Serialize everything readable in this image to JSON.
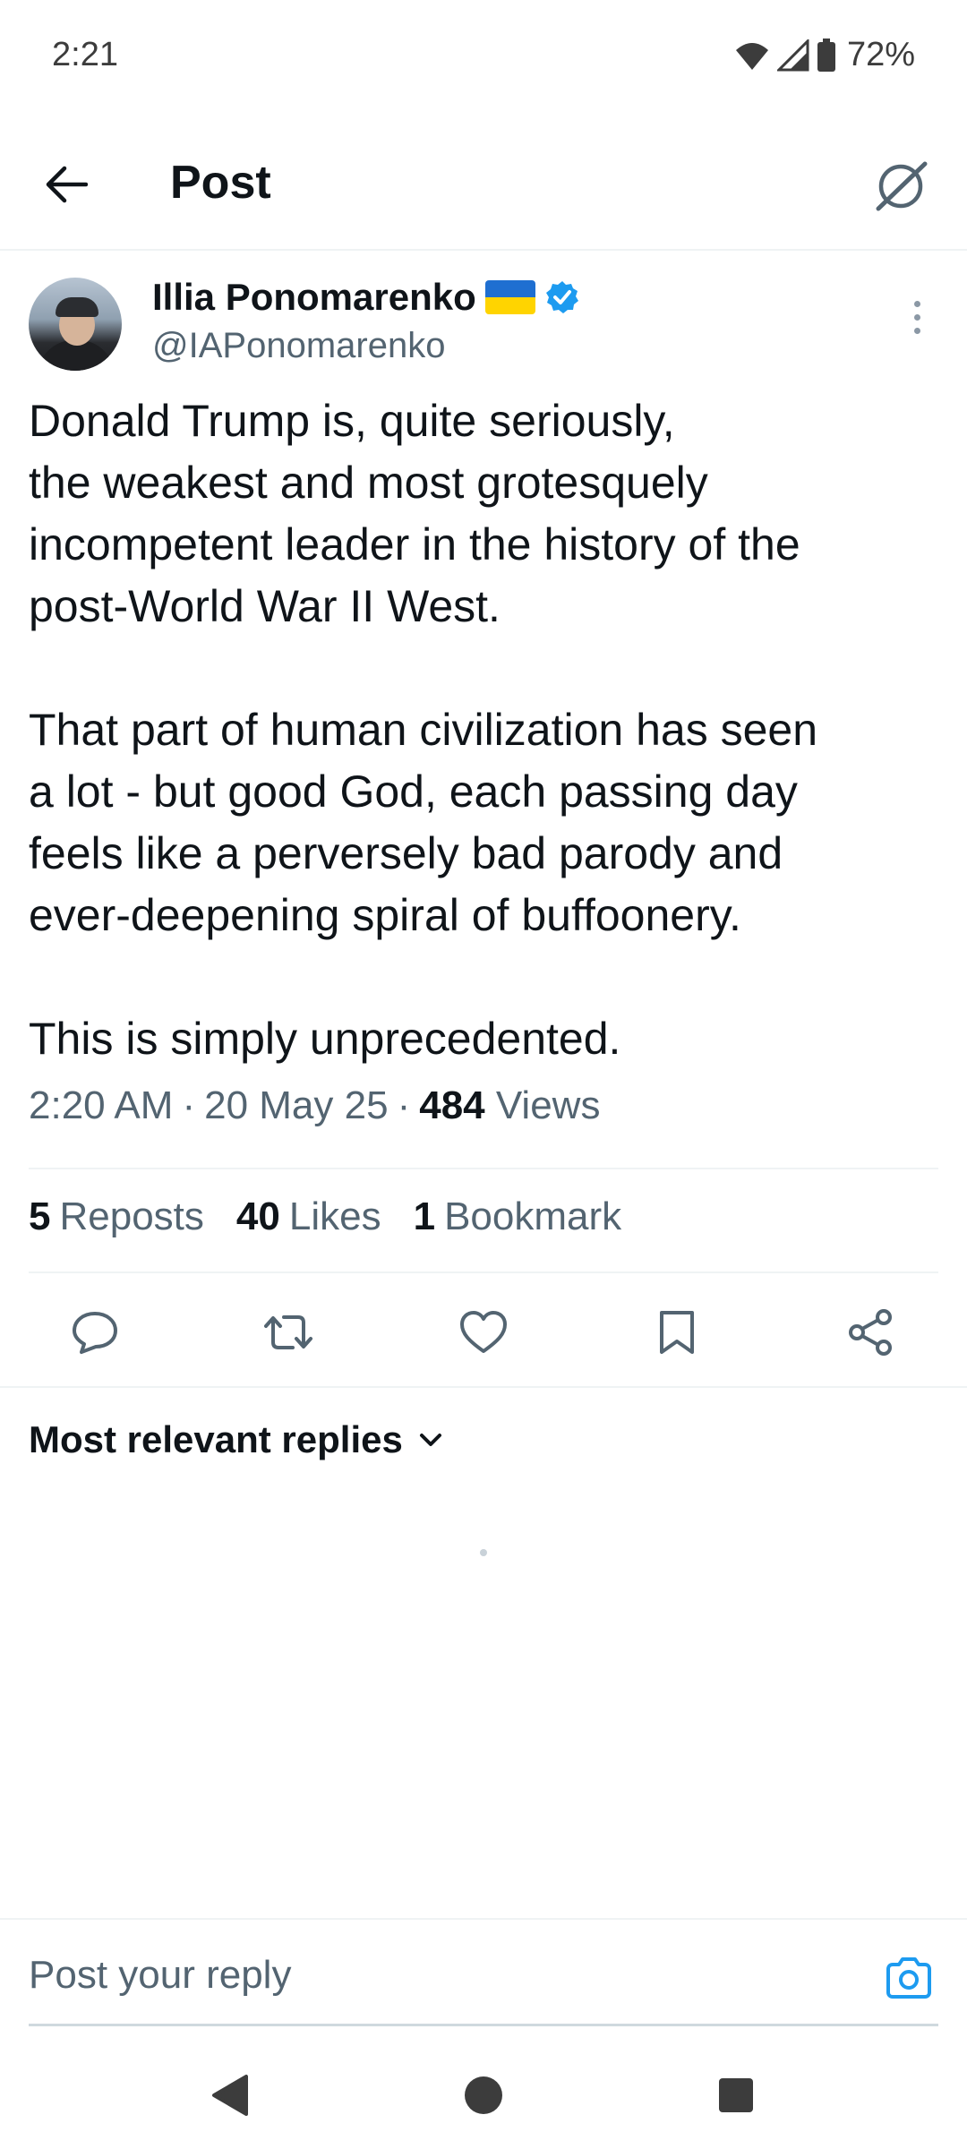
{
  "status_bar": {
    "time": "2:21",
    "battery": "72%",
    "icons": [
      "wifi-icon",
      "cellular-signal-icon",
      "battery-icon"
    ]
  },
  "header": {
    "title": "Post",
    "back_icon": "arrow-left-icon",
    "grok_icon": "grok-icon"
  },
  "post": {
    "author_name": "Illia Ponomarenko",
    "author_flag": "Ukraine flag",
    "author_verified": true,
    "author_handle": "@IAPonomarenko",
    "paragraphs": [
      [
        "Donald Trump is, quite seriously,",
        "the weakest and most grotesquely",
        "incompetent leader in the history of the",
        "post-World War II West."
      ],
      [
        "That part of human civilization has seen",
        "a lot - but good God, each passing day",
        "feels like a perversely bad parody and",
        "ever-deepening spiral of buffoonery."
      ],
      [
        "This is simply unprecedented."
      ]
    ],
    "time": "2:20 AM",
    "date": "20 May 25",
    "views_count": "484",
    "views_label": "Views"
  },
  "stats": {
    "reposts_count": "5",
    "reposts_label": "Reposts",
    "likes_count": "40",
    "likes_label": "Likes",
    "bookmarks_count": "1",
    "bookmarks_label": "Bookmark"
  },
  "actions": [
    "reply-icon",
    "repost-icon",
    "like-icon",
    "bookmark-icon",
    "share-icon"
  ],
  "replies": {
    "sort_label": "Most relevant replies"
  },
  "reply_bar": {
    "placeholder": "Post your reply"
  },
  "colors": {
    "text_primary": "#0f1419",
    "text_secondary": "#536471",
    "accent": "#1d9bf0",
    "divider": "#eff3f4"
  }
}
